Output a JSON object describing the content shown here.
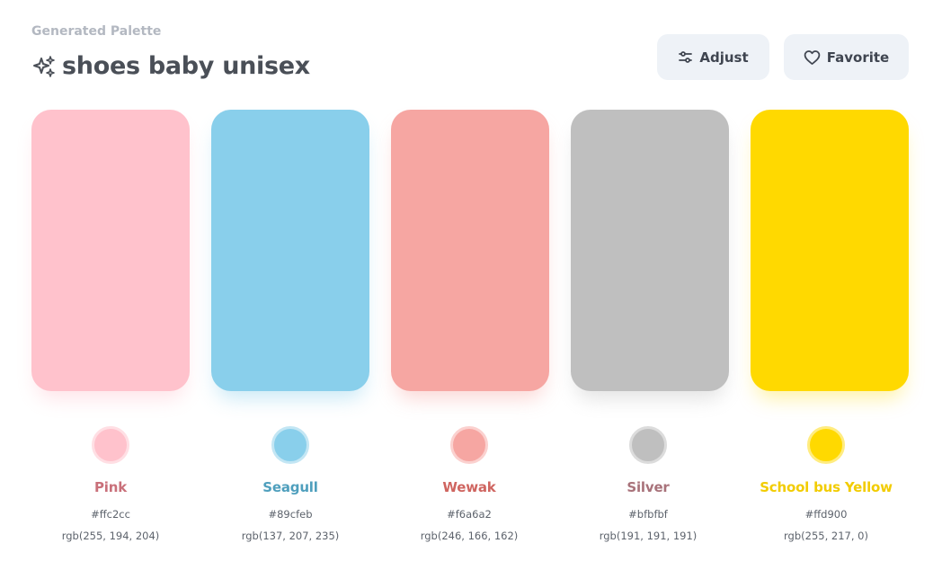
{
  "header": {
    "kicker": "Generated Palette",
    "title": "shoes baby unisex",
    "title_icon": "sparkles-icon"
  },
  "actions": {
    "adjust_label": "Adjust",
    "adjust_icon": "sliders-icon",
    "favorite_label": "Favorite",
    "favorite_icon": "heart-icon"
  },
  "colors": [
    {
      "name": "Pink",
      "hex": "#ffc2cc",
      "rgb": "rgb(255, 194, 204)",
      "label_color": "#c9707a",
      "ring_color": "#ffdfe4",
      "shadow": "rgba(255,194,204,0.45)"
    },
    {
      "name": "Seagull",
      "hex": "#89cfeb",
      "rgb": "rgb(137, 207, 235)",
      "label_color": "#4f9fbd",
      "ring_color": "#c3e6f4",
      "shadow": "rgba(137,207,235,0.45)"
    },
    {
      "name": "Wewak",
      "hex": "#f6a6a2",
      "rgb": "rgb(246, 166, 162)",
      "label_color": "#cf6560",
      "ring_color": "#fbd1cf",
      "shadow": "rgba(246,166,162,0.45)"
    },
    {
      "name": "Silver",
      "hex": "#bfbfbf",
      "rgb": "rgb(191, 191, 191)",
      "label_color": "#a8727a",
      "ring_color": "#dcdcdc",
      "shadow": "rgba(191,191,191,0.45)"
    },
    {
      "name": "School bus Yellow",
      "hex": "#ffd900",
      "rgb": "rgb(255, 217, 0)",
      "label_color": "#f2cc00",
      "ring_color": "#ffec80",
      "shadow": "rgba(255,217,0,0.35)"
    }
  ]
}
